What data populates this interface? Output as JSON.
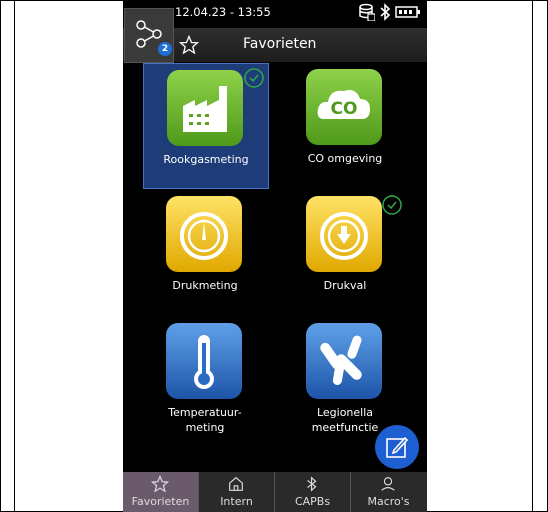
{
  "status": {
    "datetime": "12.04.23 - 13:55"
  },
  "header": {
    "title": "Favorieten",
    "badge_count": "2"
  },
  "tiles": [
    {
      "label": "Rookgasmeting",
      "icon": "factory-icon",
      "color": "#6bb52a",
      "selected": true,
      "checked": true
    },
    {
      "label": "CO omgeving",
      "icon": "co-cloud-icon",
      "color": "#6bb52a",
      "selected": false,
      "checked": false
    },
    {
      "label": "Drukmeting",
      "icon": "gauge-icon",
      "color": "#f2c40c",
      "selected": false,
      "checked": false
    },
    {
      "label": "Drukval",
      "icon": "gauge-down-icon",
      "color": "#f2c40c",
      "selected": false,
      "checked": true
    },
    {
      "label_line1": "Temperatuur-",
      "label_line2": "meting",
      "icon": "thermometer-icon",
      "color": "#2a6cc4",
      "selected": false,
      "checked": false
    },
    {
      "label_line1": "Legionella",
      "label_line2": "meetfunctie",
      "icon": "legionella-icon",
      "color": "#2a6cc4",
      "selected": false,
      "checked": false
    }
  ],
  "nav": [
    {
      "label": "Favorieten",
      "icon": "star-icon",
      "active": true
    },
    {
      "label": "Intern",
      "icon": "home-icon",
      "active": false
    },
    {
      "label": "CAPBs",
      "icon": "bluetooth-icon",
      "active": false
    },
    {
      "label": "Macro's",
      "icon": "user-icon",
      "active": false
    }
  ]
}
